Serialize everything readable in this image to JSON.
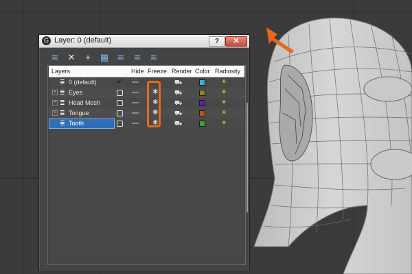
{
  "dialog": {
    "title": "Layer: 0 (default)",
    "help_label": "?",
    "close_label": "✕"
  },
  "toolbar": [
    {
      "icon": "new-layer-icon",
      "glyph": "≋"
    },
    {
      "icon": "delete-icon",
      "glyph": "✕"
    },
    {
      "icon": "add-icon",
      "glyph": "+"
    },
    {
      "icon": "select-icon",
      "glyph": "▦"
    },
    {
      "icon": "highlight-icon",
      "glyph": "≋"
    },
    {
      "icon": "hide-all-icon",
      "glyph": "≋"
    },
    {
      "icon": "freeze-all-icon",
      "glyph": "≋"
    }
  ],
  "columns": {
    "layers": "Layers",
    "hide": "Hide",
    "freeze": "Freeze",
    "render": "Render",
    "color": "Color",
    "radiosity": "Radiosity"
  },
  "rows": [
    {
      "name": "0 (default)",
      "expandable": false,
      "current": true,
      "color": null
    },
    {
      "name": "Eyes",
      "expandable": true,
      "current": false,
      "color": "#8a8a1e"
    },
    {
      "name": "Head Mesh",
      "expandable": true,
      "current": false,
      "color": "#6a1ea0"
    },
    {
      "name": "Tongue",
      "expandable": true,
      "current": false,
      "color": "#c0501e"
    },
    {
      "name": "Tooth",
      "expandable": false,
      "current": false,
      "selected": true,
      "color": "#3aa03a"
    }
  ],
  "default_layer_color": "#3ab0d0",
  "colors": {
    "accent_orange": "#e8681e",
    "selection_blue": "#2f6fb8"
  }
}
